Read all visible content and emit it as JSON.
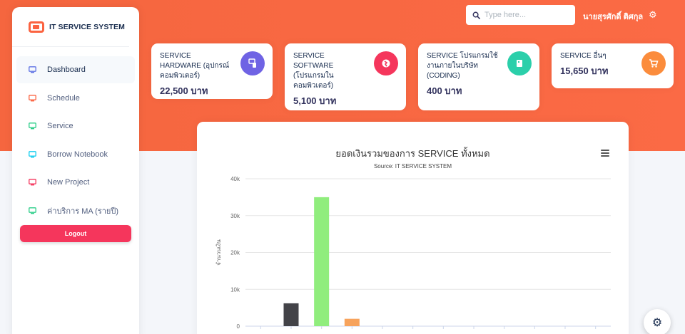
{
  "brand": {
    "name": "IT SERVICE SYSTEM"
  },
  "sidebar": {
    "items": [
      {
        "label": "Dashboard",
        "icon": "monitor-icon",
        "color": "#5e72e4",
        "active": true
      },
      {
        "label": "Schedule",
        "icon": "calendar-icon",
        "color": "#fb6340"
      },
      {
        "label": "Service",
        "icon": "tv-icon",
        "color": "#2dce89"
      },
      {
        "label": "Borrow Notebook",
        "icon": "box-icon",
        "color": "#11cdef"
      },
      {
        "label": "New Project",
        "icon": "globe-icon",
        "color": "#f5365c"
      },
      {
        "label": "ค่าบริการ MA (รายปี)",
        "icon": "credit-card-icon",
        "color": "#2dce89"
      }
    ],
    "logout_label": "Logout"
  },
  "topbar": {
    "search_placeholder": "Type here...",
    "username": "นายสุรศักดิ์ ติศกุล"
  },
  "cards": [
    {
      "title": "SERVICE HARDWARE (อุปกรณ์คอมพิวเตอร์)",
      "value": "22,500 บาท",
      "icon": "hardware-icon",
      "color": "#6f63e4"
    },
    {
      "title": "SERVICE SOFTWARE (โปรแกรมในคอมพิวเตอร์)",
      "value": "5,100 บาท",
      "icon": "software-icon",
      "color": "#f5365c"
    },
    {
      "title": "SERVICE โปรแกรมใช้งานภายในบริษัท (CODING)",
      "value": "400 บาท",
      "icon": "coding-icon",
      "color": "#2bcfaa"
    },
    {
      "title": "SERVICE อื่นๆ",
      "value": "15,650 บาท",
      "icon": "cart-icon",
      "color": "#fb8c3c"
    }
  ],
  "chart_data": {
    "type": "bar",
    "title": "ยอดเงินรวมของการ SERVICE ทั้งหมด",
    "subtitle": "Source: IT SERVICE SYSTEM",
    "ylabel": "จำนวนเงิน",
    "yticks": [
      "0",
      "10k",
      "20k",
      "30k",
      "40k"
    ],
    "ylim": [
      0,
      40000
    ],
    "categories": [
      "",
      "",
      "",
      "",
      "",
      "",
      "",
      "",
      "",
      "",
      "",
      ""
    ],
    "values": [
      0,
      6200,
      35000,
      2000,
      0,
      0,
      0,
      0,
      0,
      0,
      0,
      0
    ],
    "colors": [
      "#7cb5ec",
      "#434348",
      "#90ed7d",
      "#f7a35c",
      "#8085e9",
      "#f15c80",
      "#e4d354",
      "#2b908f",
      "#f45b5b",
      "#91e8e1",
      "#7cb5ec",
      "#434348"
    ],
    "grid": true,
    "legend": "none"
  }
}
